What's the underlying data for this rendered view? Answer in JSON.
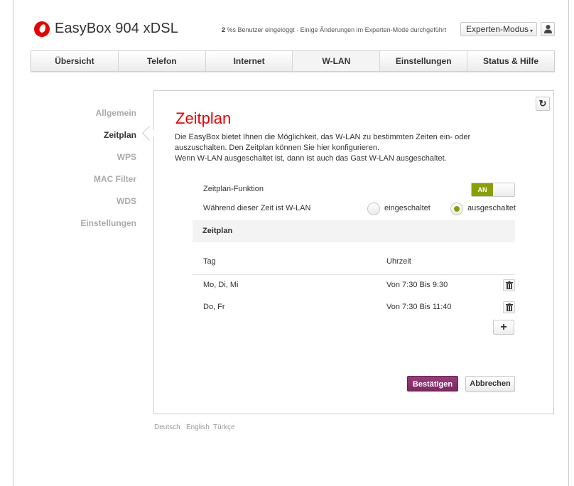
{
  "header": {
    "title": "EasyBox 904 xDSL",
    "status_count": "2",
    "status_text": " %s Benutzer eingeloggt · Einige Änderungen im Experten-Mode durchgeführt",
    "mode_selected": "Experten-Modus",
    "mode_caret": "▾"
  },
  "nav": {
    "tabs": [
      {
        "label": "Übersicht"
      },
      {
        "label": "Telefon"
      },
      {
        "label": "Internet"
      },
      {
        "label": "W-LAN",
        "active": true
      },
      {
        "label": "Einstellungen"
      },
      {
        "label": "Status & Hilfe"
      }
    ]
  },
  "sidebar": {
    "items": [
      {
        "label": "Allgemein"
      },
      {
        "label": "Zeitplan",
        "active": true
      },
      {
        "label": "WPS"
      },
      {
        "label": "MAC Filter"
      },
      {
        "label": "WDS"
      },
      {
        "label": "Einstellungen"
      }
    ]
  },
  "main": {
    "reset_glyph": "↻",
    "title": "Zeitplan",
    "intro_line1": "Die EasyBox bietet Ihnen die Möglichkeit, das W-LAN zu bestimmten Zeiten ein- oder auszuschalten. Den Zeitplan können Sie hier konfigurieren.",
    "intro_line2": "Wenn W-LAN ausgeschaltet ist, dann ist auch das Gast W-LAN ausgeschaltet.",
    "function_label": "Zeitplan-Funktion",
    "toggle_on_label": "AN",
    "wlan_during_label": "Während dieser Zeit ist W-LAN",
    "radio_on_label": "eingeschaltet",
    "radio_off_label": "ausgeschaltet",
    "radio_selected": "ausgeschaltet",
    "section_title": "Zeitplan",
    "col_day": "Tag",
    "col_time": "Uhrzeit",
    "rows": [
      {
        "day": "Mo, Di, Mi",
        "time": "Von 7:30 Bis 9:30"
      },
      {
        "day": "Do, Fr",
        "time": "Von 7:30 Bis 11:40"
      }
    ],
    "add_glyph": "+",
    "confirm_label": "Bestätigen",
    "cancel_label": "Abbrechen"
  },
  "footer": {
    "languages": [
      "Deutsch",
      "English",
      "Türkçe"
    ]
  },
  "colors": {
    "brand_red": "#e60000",
    "toggle_green": "#8aa000",
    "confirm_purple": "#7b2862"
  }
}
